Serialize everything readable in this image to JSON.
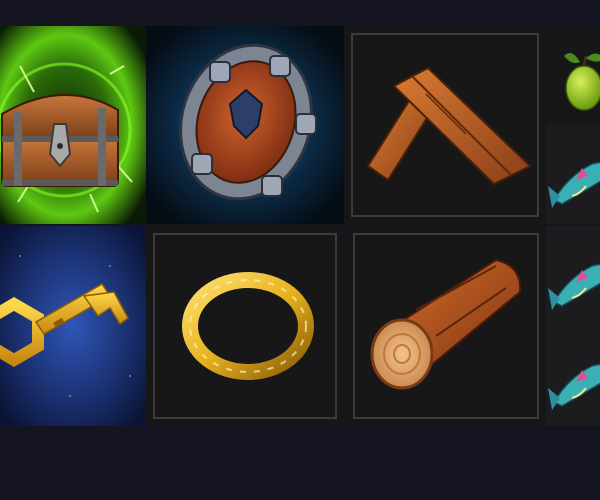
{
  "page": {
    "background": "#141521"
  },
  "inventory": {
    "items": [
      {
        "icon": "treasure-chest-icon",
        "rarity_glow": "#6fe01b"
      },
      {
        "icon": "shield-icon",
        "rarity_glow": "#2e8fd6"
      },
      {
        "icon": "wooden-planks-icon"
      },
      {
        "icon": "apple-icon"
      },
      {
        "icon": "fish-icon"
      },
      {
        "icon": "key-icon",
        "rarity_glow": "#2f56b8"
      },
      {
        "icon": "gold-ring-icon"
      },
      {
        "icon": "wood-log-icon"
      },
      {
        "icon": "fish-icon"
      },
      {
        "icon": "fish-icon"
      }
    ]
  },
  "colors": {
    "panel_dark": "#171718",
    "frame": "#3c3c3e",
    "wood": "#b85a22",
    "gold": "#e8b21e",
    "steel": "#8b95a5",
    "fish": "#3ab0b5"
  }
}
